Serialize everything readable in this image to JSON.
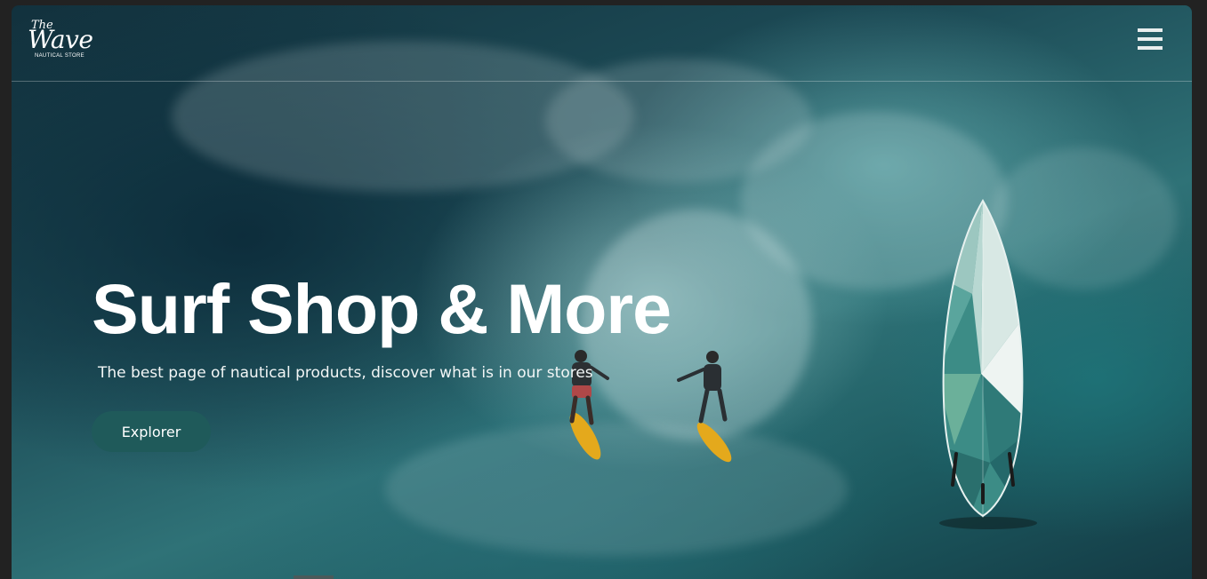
{
  "brand": {
    "logo_the": "The",
    "logo_wave": "Wave",
    "logo_sub": "NAUTICAL STORE"
  },
  "nav": {
    "menu_icon": "hamburger-menu-icon"
  },
  "hero": {
    "title": "Surf Shop & More",
    "subtitle": "The best page of nautical products, discover what is in our stores",
    "cta_label": "Explorer"
  },
  "colors": {
    "cta_background": "#1f5a5a",
    "ocean_dark": "#12313d",
    "ocean_teal": "#2f7277",
    "text": "#ffffff"
  },
  "decor": {
    "surfboard_icon": "surfboard-illustration",
    "surfers_image": "surfers-riding-wave"
  }
}
